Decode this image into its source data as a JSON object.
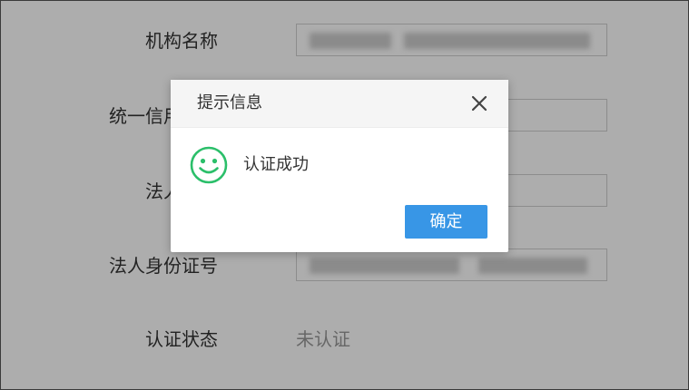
{
  "form": {
    "rows": [
      {
        "label": "机构名称"
      },
      {
        "label": "统一信用代码"
      },
      {
        "label": "法人姓名"
      },
      {
        "label": "法人身份证号"
      }
    ],
    "status": {
      "label": "认证状态",
      "value": "未认证"
    }
  },
  "dialog": {
    "title": "提示信息",
    "message": "认证成功",
    "ok_label": "确定",
    "close_icon": "close-icon",
    "status_icon": "smile-icon"
  },
  "colors": {
    "accent": "#3896e6",
    "success": "#2bbf6a",
    "overlay": "rgba(0,0,0,0.32)"
  }
}
